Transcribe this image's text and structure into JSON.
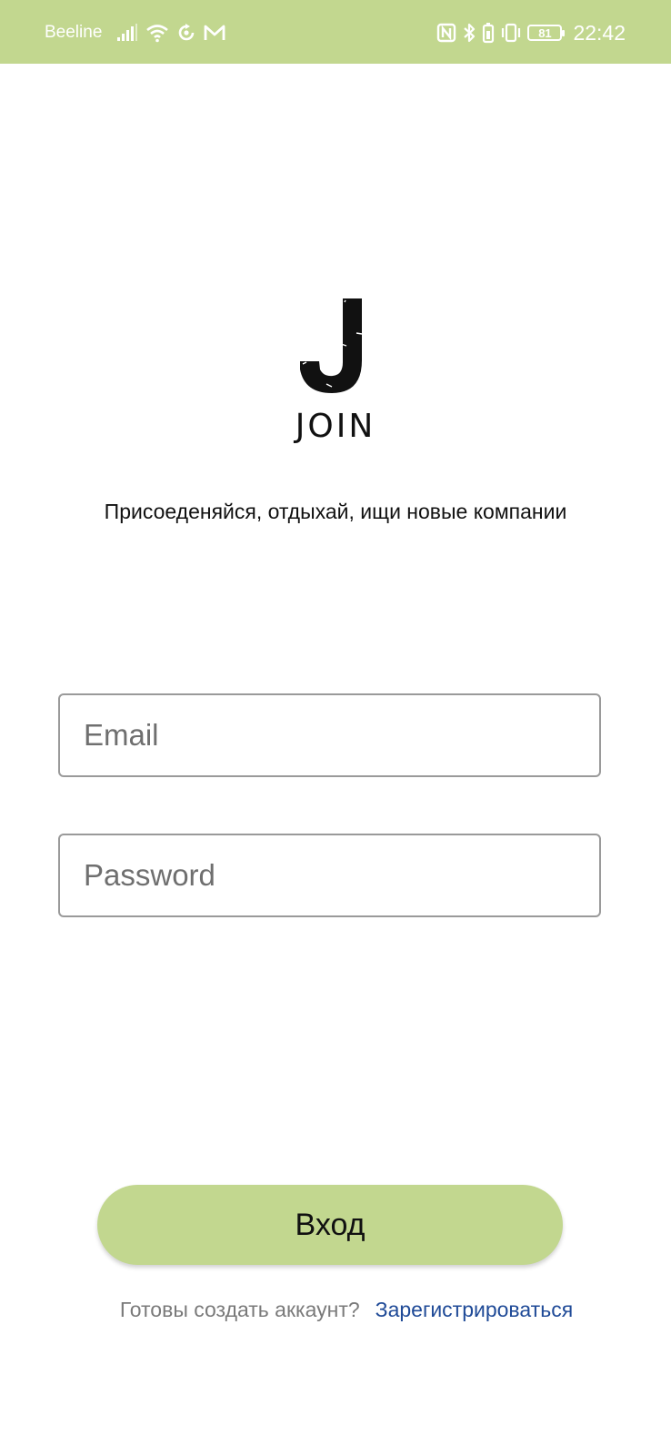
{
  "status_bar": {
    "carrier": "Beeline",
    "time": "22:42",
    "battery_level": "81",
    "background_color": "#c2d78f",
    "icons": [
      "signal-icon",
      "wifi-icon",
      "sync-icon",
      "mail-icon",
      "nfc-icon",
      "bluetooth-icon",
      "battery-saver-icon",
      "vibrate-icon",
      "battery-icon"
    ]
  },
  "logo": {
    "letter": "J",
    "name": "JOIN"
  },
  "tagline": "Присоеденяйся, отдыхай, ищи новые компании",
  "form": {
    "email_placeholder": "Email",
    "password_placeholder": "Password",
    "login_label": "Вход",
    "button_color": "#c2d78f"
  },
  "register": {
    "prompt": "Готовы создать аккаунт?",
    "link_label": "Зарегистрироваться",
    "link_color": "#1f4a97"
  }
}
